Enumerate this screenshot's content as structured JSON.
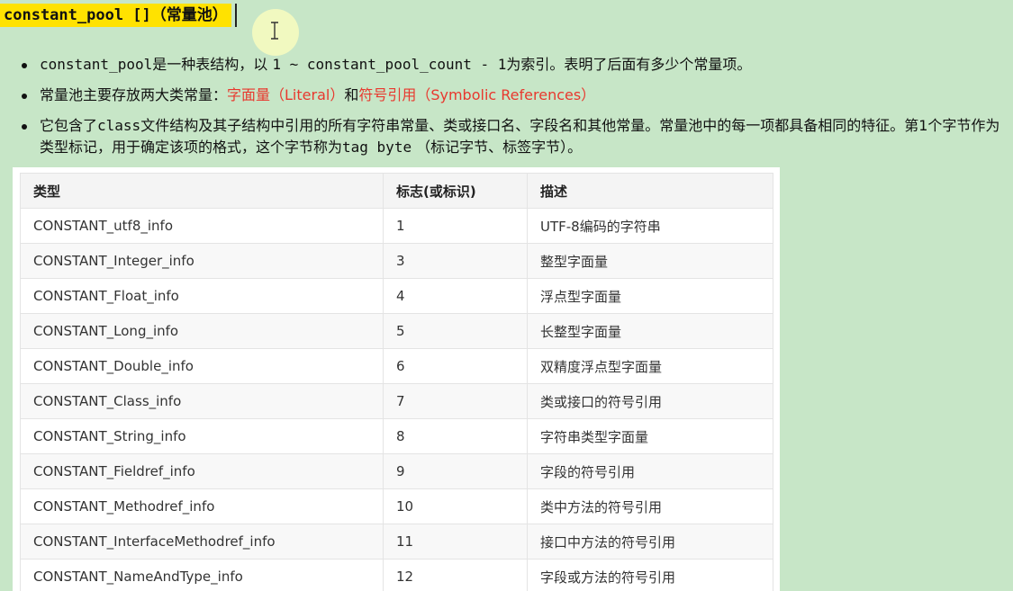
{
  "heading": {
    "text": "constant_pool []（常量池）"
  },
  "bullets": [
    {
      "code1": "constant_pool",
      "text1": "是一种表结构，以 ",
      "code2": "1 ~ constant_pool_count - 1",
      "text2": "为索引。表明了后面有多少个常量项。"
    },
    {
      "text1": "常量池主要存放两大类常量：",
      "red1": "字面量（Literal）",
      "text2": "和",
      "red2": "符号引用（Symbolic References）"
    },
    {
      "text1": "它包含了",
      "code1": "class",
      "text2": "文件结构及其子结构中引用的所有字符串常量、类或接口名、字段名和其他常量。常量池中的每一项都具备相同的特征。第1个字节作为类型标记，用于确定该项的格式，这个字节称为",
      "code2": "tag byte",
      "text3": " （标记字节、标签字节）。"
    }
  ],
  "table": {
    "headers": [
      "类型",
      "标志(或标识)",
      "描述"
    ],
    "rows": [
      [
        "CONSTANT_utf8_info",
        "1",
        "UTF-8编码的字符串"
      ],
      [
        "CONSTANT_Integer_info",
        "3",
        "整型字面量"
      ],
      [
        "CONSTANT_Float_info",
        "4",
        "浮点型字面量"
      ],
      [
        "CONSTANT_Long_info",
        "5",
        "长整型字面量"
      ],
      [
        "CONSTANT_Double_info",
        "6",
        "双精度浮点型字面量"
      ],
      [
        "CONSTANT_Class_info",
        "7",
        "类或接口的符号引用"
      ],
      [
        "CONSTANT_String_info",
        "8",
        "字符串类型字面量"
      ],
      [
        "CONSTANT_Fieldref_info",
        "9",
        "字段的符号引用"
      ],
      [
        "CONSTANT_Methodref_info",
        "10",
        "类中方法的符号引用"
      ],
      [
        "CONSTANT_InterfaceMethodref_info",
        "11",
        "接口中方法的符号引用"
      ],
      [
        "CONSTANT_NameAndType_info",
        "12",
        "字段或方法的符号引用"
      ]
    ]
  },
  "colors": {
    "background": "#c7e6c7",
    "highlight": "#ffe200",
    "accent_red": "#e8382e"
  },
  "icons": {
    "cursor": "text-cursor-ibeam-icon"
  }
}
